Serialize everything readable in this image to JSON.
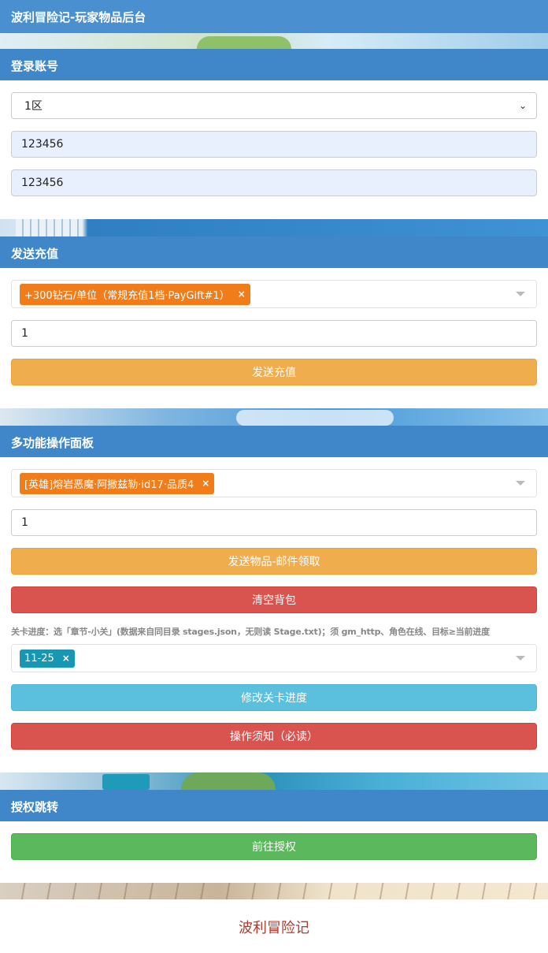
{
  "title": "波利冒险记-玩家物品后台",
  "login": {
    "header": "登录账号",
    "server_selected": "1区",
    "account": "123456",
    "password": "123456"
  },
  "recharge": {
    "header": "发送充值",
    "selected_tag": "+300钻石/单位（常规充值1档·PayGift#1）",
    "quantity": "1",
    "send_label": "发送充值"
  },
  "multi": {
    "header": "多功能操作面板",
    "selected_item": "[英雄]熔岩恶魔·阿撒兹勒·id17·品质4",
    "quantity": "1",
    "send_item_label": "发送物品-邮件领取",
    "clear_bag_label": "清空背包",
    "stage_hint": "关卡进度：选「章节-小关」(数据来自同目录 stages.json，无则读 Stage.txt)；须 gm_http、角色在线、目标≥当前进度",
    "stage_tag": "11-25",
    "modify_stage_label": "修改关卡进度",
    "notice_label": "操作须知（必读）"
  },
  "auth": {
    "header": "授权跳转",
    "goto_label": "前往授权"
  },
  "footer": "波利冒险记",
  "colors": {
    "header": "#3f87c8",
    "orange": "#f0ad4e",
    "red": "#d9534f",
    "cyan": "#5bc0de",
    "green": "#5cb85c",
    "tag_orange": "#f07d1a",
    "tag_teal": "#1996b3"
  }
}
